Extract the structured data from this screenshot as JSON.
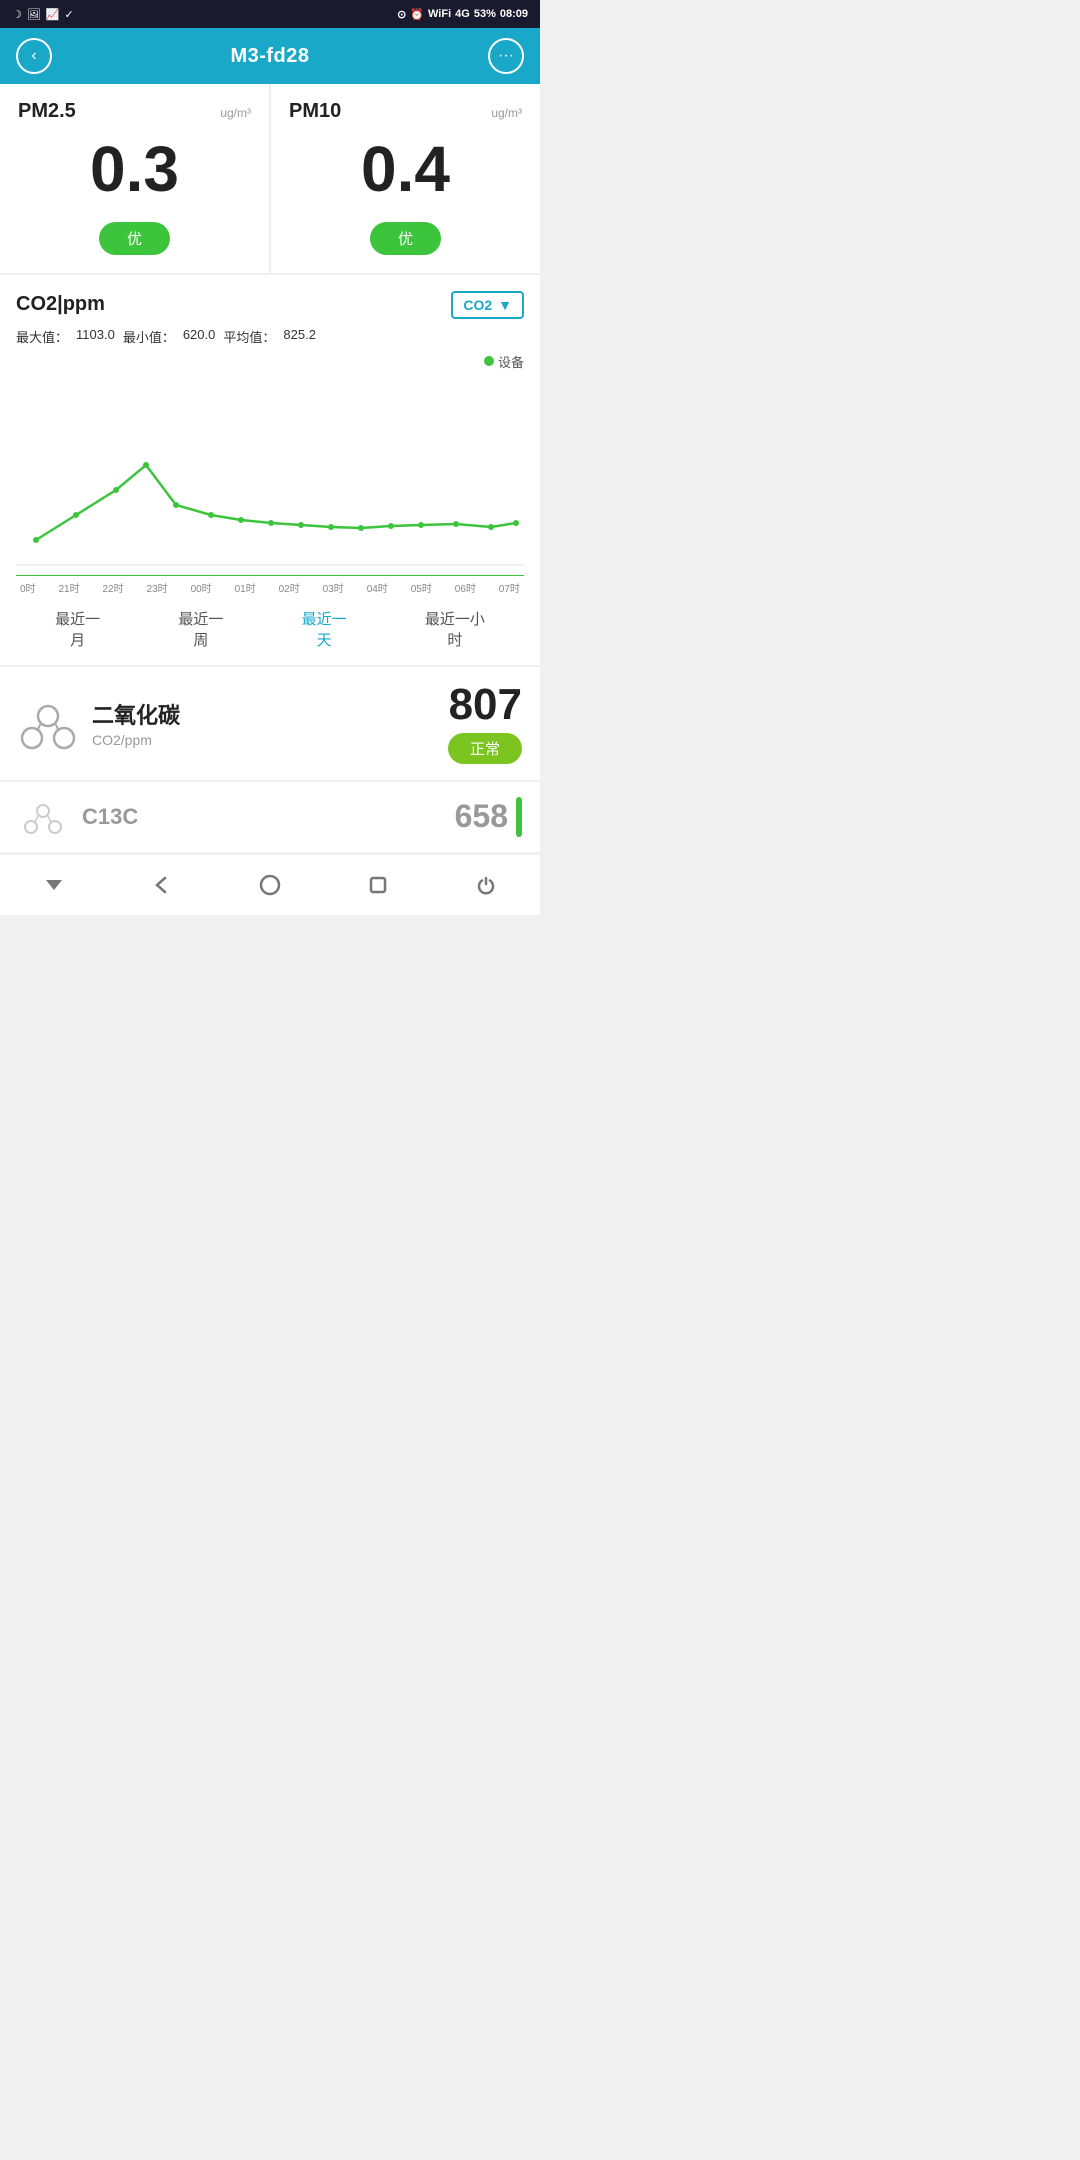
{
  "statusBar": {
    "time": "08:09",
    "battery": "53%",
    "signal": "4G"
  },
  "header": {
    "title": "M3-fd28",
    "backLabel": "‹",
    "menuLabel": "···"
  },
  "pm25": {
    "title": "PM2.5",
    "unit": "ug/m³",
    "value": "0.3",
    "badge": "优"
  },
  "pm10": {
    "title": "PM10",
    "unit": "ug/m³",
    "value": "0.4",
    "badge": "优"
  },
  "co2Chart": {
    "title": "CO2|ppm",
    "dropdownLabel": "CO2",
    "maxLabel": "最大值：",
    "maxValue": "1103.0",
    "minLabel": "最小值：",
    "minValue": "620.0",
    "avgLabel": "平均值：",
    "avgValue": "825.2",
    "legendLabel": "设备",
    "xLabels": [
      "0时",
      "21时",
      "22时",
      "23时",
      "00时",
      "01时",
      "02时",
      "03时",
      "04时",
      "05时",
      "06时",
      "07时"
    ]
  },
  "timeRanges": [
    {
      "label": "最近一\n月",
      "active": false
    },
    {
      "label": "最近一\n周",
      "active": false
    },
    {
      "label": "最近一\n天",
      "active": true
    },
    {
      "label": "最近一小\n时",
      "active": false
    }
  ],
  "sensorCO2": {
    "name": "二氧化碳",
    "sub": "CO2/ppm",
    "value": "807",
    "badge": "正常"
  },
  "partialCard": {
    "icon": "~",
    "text": "C13C",
    "value": "658"
  },
  "colors": {
    "headerBg": "#1aa8c8",
    "green": "#3cc43c",
    "teal": "#1aa8c8",
    "yellowGreen": "#7cc420"
  }
}
